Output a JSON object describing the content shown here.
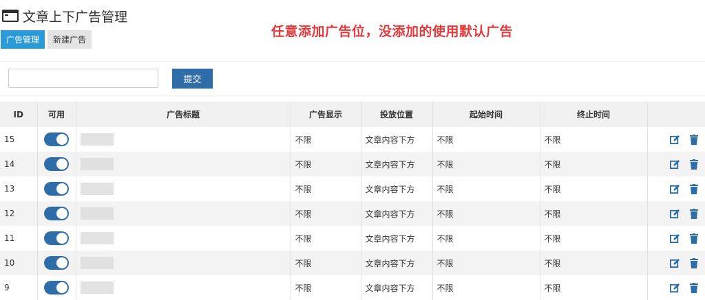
{
  "header": {
    "title": "文章上下广告管理",
    "notice": "任意添加广告位，没添加的使用默认广告"
  },
  "tabs": [
    {
      "label": "广告管理"
    },
    {
      "label": "新建广告"
    }
  ],
  "toolbar": {
    "search_placeholder": "",
    "submit_label": "提交"
  },
  "table": {
    "columns": [
      "ID",
      "可用",
      "广告标题",
      "广告显示",
      "投放位置",
      "起始时间",
      "终止时间",
      ""
    ],
    "rows": [
      {
        "id": "15",
        "display": "不限",
        "position": "文章内容下方",
        "start": "不限",
        "end": "不限"
      },
      {
        "id": "14",
        "display": "不限",
        "position": "文章内容下方",
        "start": "不限",
        "end": "不限"
      },
      {
        "id": "13",
        "display": "不限",
        "position": "文章内容下方",
        "start": "不限",
        "end": "不限"
      },
      {
        "id": "12",
        "display": "不限",
        "position": "文章内容下方",
        "start": "不限",
        "end": "不限"
      },
      {
        "id": "11",
        "display": "不限",
        "position": "文章内容下方",
        "start": "不限",
        "end": "不限"
      },
      {
        "id": "10",
        "display": "不限",
        "position": "文章内容下方",
        "start": "不限",
        "end": "不限"
      },
      {
        "id": "9",
        "display": "不限",
        "position": "文章内容下方",
        "start": "不限",
        "end": "不限"
      }
    ]
  },
  "colors": {
    "primary": "#2f6da8",
    "tab_active": "#2b9ad9",
    "notice": "#e5383b"
  }
}
